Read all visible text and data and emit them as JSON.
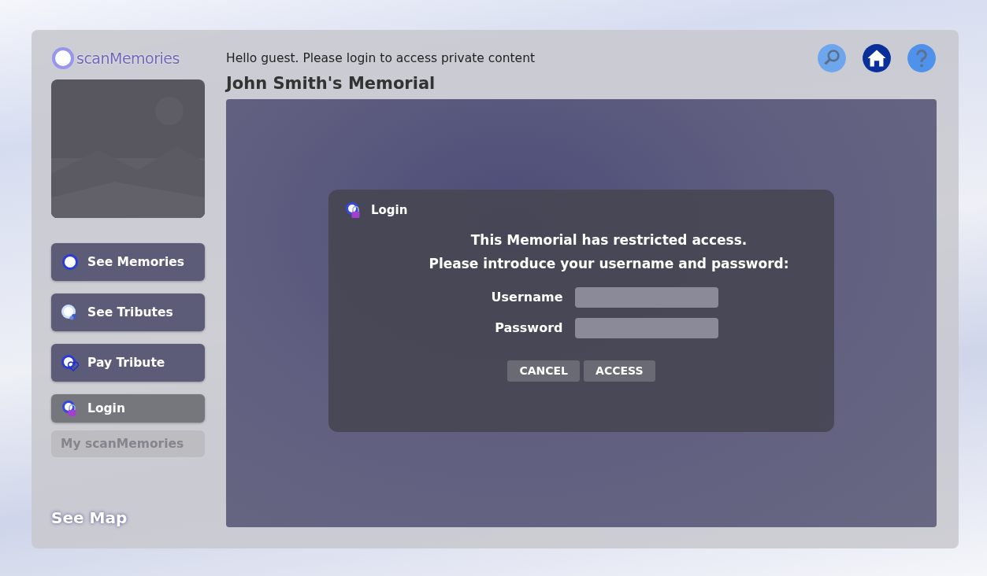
{
  "logo": {
    "text": "scanMemories"
  },
  "greeting": "Hello guest. Please login to access private content",
  "toolbar": [
    {
      "kind": "search"
    },
    {
      "kind": "home",
      "selected": true
    },
    {
      "kind": "help"
    }
  ],
  "title": "John Smith's Memorial",
  "sidebar": {
    "items": [
      {
        "kind": "memories",
        "label": "See Memories",
        "selected": false,
        "disabled": false
      },
      {
        "kind": "tributes",
        "label": "See Tributes",
        "selected": false,
        "disabled": false
      },
      {
        "kind": "pay",
        "label": "Pay Tribute",
        "selected": false,
        "disabled": false
      },
      {
        "kind": "login",
        "label": "Login",
        "selected": true,
        "disabled": false
      },
      {
        "kind": "none",
        "label": "My scanMemories",
        "selected": false,
        "disabled": true
      }
    ],
    "map_link": "See Map"
  },
  "dialog": {
    "title": "Login",
    "message_lines": [
      "This Memorial has restricted access.",
      "Please introduce your username and password:"
    ],
    "fields": [
      {
        "label": "Username"
      },
      {
        "label": "Password"
      }
    ],
    "buttons": [
      "CANCEL",
      "ACCESS"
    ]
  }
}
